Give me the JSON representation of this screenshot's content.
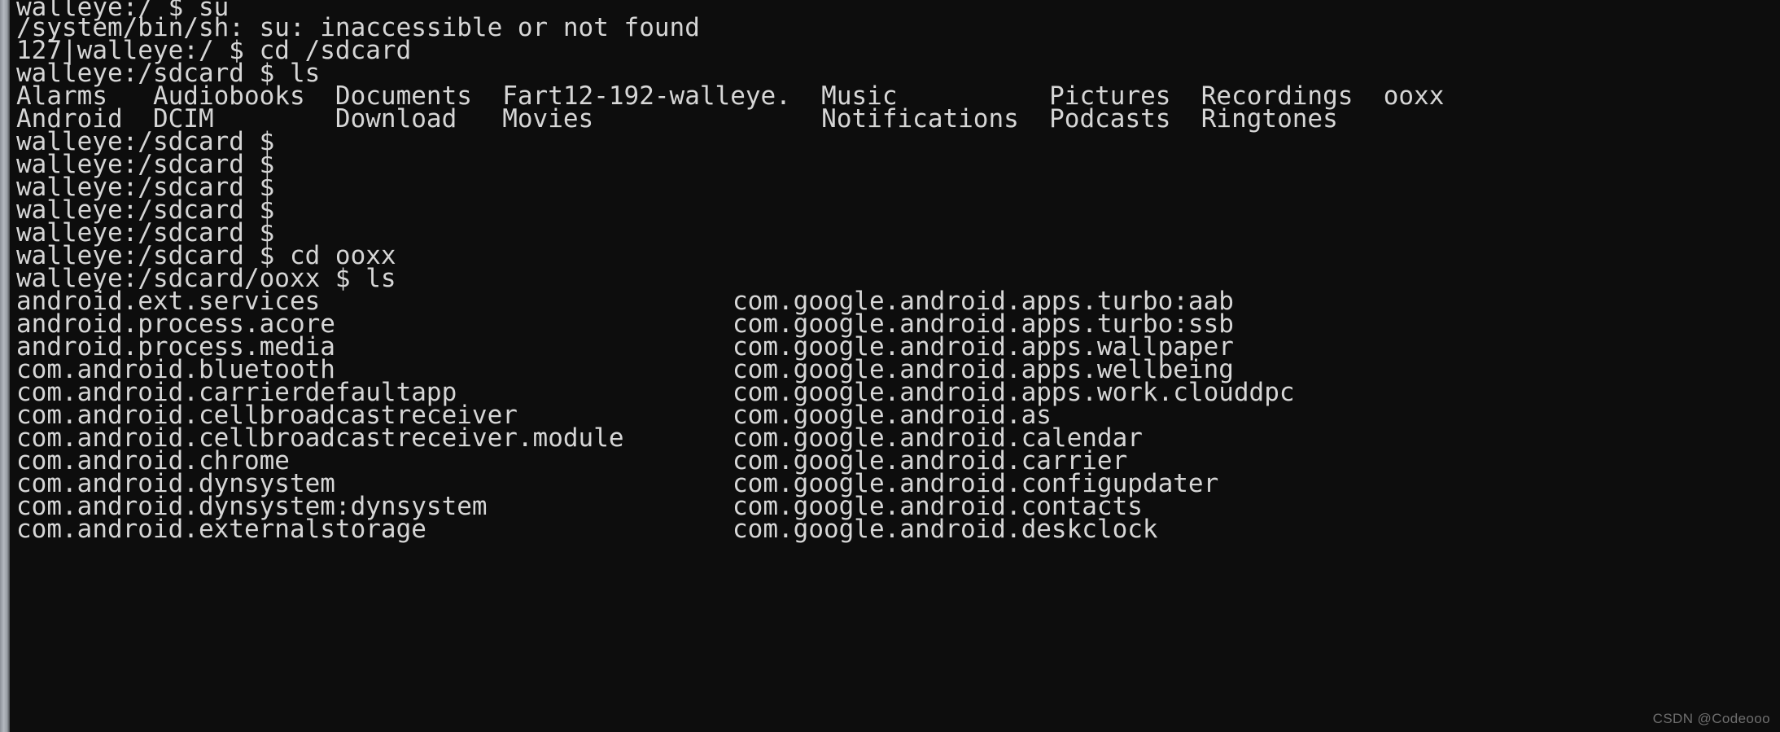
{
  "terminal": {
    "background_color": "#0d0d0d",
    "foreground_color": "#d6d6d6",
    "watermark": "CSDN @Codeooo",
    "lines": [
      {
        "id": "prompt-su",
        "text": "walleye:/ $ su"
      },
      {
        "id": "error-su-not-found",
        "text": "/system/bin/sh: su: inaccessible or not found"
      },
      {
        "id": "prompt-cd-sdcard",
        "text": "127|walleye:/ $ cd /sdcard"
      },
      {
        "id": "prompt-ls-sdcard",
        "text": "walleye:/sdcard $ ls"
      },
      {
        "id": "ls-row-1",
        "text": "Alarms   Audiobooks  Documents  Fart12-192-walleye.  Music          Pictures  Recordings  ooxx"
      },
      {
        "id": "ls-row-2",
        "text": "Android  DCIM        Download   Movies               Notifications  Podcasts  Ringtones"
      },
      {
        "id": "prompt-empty-1",
        "text": "walleye:/sdcard $ "
      },
      {
        "id": "prompt-empty-2",
        "text": "walleye:/sdcard $ "
      },
      {
        "id": "prompt-empty-3",
        "text": "walleye:/sdcard $ "
      },
      {
        "id": "prompt-empty-4",
        "text": "walleye:/sdcard $ "
      },
      {
        "id": "prompt-empty-5",
        "text": "walleye:/sdcard $ "
      },
      {
        "id": "prompt-cd-ooxx",
        "text": "walleye:/sdcard $ cd ooxx"
      },
      {
        "id": "prompt-ls-ooxx",
        "text": "walleye:/sdcard/ooxx $ ls"
      }
    ],
    "package_listing": {
      "left_column": [
        "android.ext.services",
        "android.process.acore",
        "android.process.media",
        "com.android.bluetooth",
        "com.android.carrierdefaultapp",
        "com.android.cellbroadcastreceiver",
        "com.android.cellbroadcastreceiver.module",
        "com.android.chrome",
        "com.android.dynsystem",
        "com.android.dynsystem:dynsystem",
        "com.android.externalstorage"
      ],
      "right_column": [
        "com.google.android.apps.turbo:aab",
        "com.google.android.apps.turbo:ssb",
        "com.google.android.apps.wallpaper",
        "com.google.android.apps.wellbeing",
        "com.google.android.apps.work.clouddpc",
        "com.google.android.as",
        "com.google.android.calendar",
        "com.google.android.carrier",
        "com.google.android.configupdater",
        "com.google.android.contacts",
        "com.google.android.deskclock"
      ]
    },
    "sdcard_entries": [
      "Alarms",
      "Audiobooks",
      "Documents",
      "Fart12-192-walleye.",
      "Music",
      "Pictures",
      "Recordings",
      "ooxx",
      "Android",
      "DCIM",
      "Download",
      "Movies",
      "Notifications",
      "Podcasts",
      "Ringtones"
    ],
    "commands_run": [
      "su",
      "cd /sdcard",
      "ls",
      "cd ooxx",
      "ls"
    ],
    "device_name": "walleye",
    "current_directory": "/sdcard/ooxx"
  }
}
